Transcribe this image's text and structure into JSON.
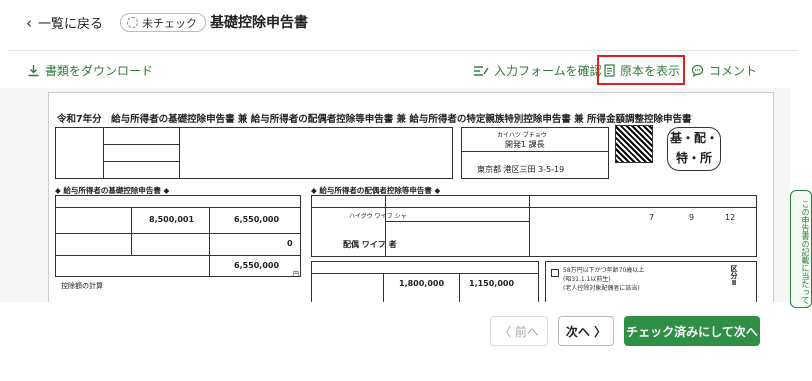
{
  "header": {
    "back_label": "一覧に戻る",
    "status_badge": "未チェック",
    "title": "基礎控除申告書"
  },
  "toolbar": {
    "download_label": "書類をダウンロード",
    "confirm_form_label": "入力フォームを確認",
    "show_original_label": "原本を表示",
    "comment_label": "コメント"
  },
  "document": {
    "title": "令和7年分　給与所得者の基礎控除申告書 兼 給与所得者の配偶者控除等申告書 兼 給与所得者の特定親族特別控除申告書 兼 所得金額調整控除申告書",
    "employee_kana": "カイハツ ブチョウ",
    "employee_name": "開発1 課長",
    "address": "東京都 港区三田 3-5-19",
    "stamp_line1": "基・配・",
    "stamp_line2": "特・所",
    "section_basic": "◆ 給与所得者の基礎控除申告書 ◆",
    "section_spouse": "◆ 給与所得者の配偶者控除等申告書 ◆",
    "salary_income": "8,500,001",
    "salary_amount": "6,550,000",
    "other_income": "0",
    "total_income": "6,550,000",
    "spouse_kana": "ハイグウ ワイフ シャ",
    "spouse_name": "配偶 ワイフ 者",
    "spouse_birth_month": "7",
    "spouse_birth_day": "9",
    "spouse_birth_unit": "12",
    "spouse_salary_income": "1,800,000",
    "spouse_salary_amount": "1,150,000",
    "spouse_note1": "58万円以下かつ年齢70歳以上",
    "spouse_note2": "(昭31.1.1以前生)",
    "spouse_note3": "(老人控除対象配偶者に該当)",
    "calc_label": "控除額の計算",
    "unit_yen": "円",
    "category_label": "区分Ⅱ"
  },
  "side_tab": {
    "label": "この申告書の記載に当たって"
  },
  "footer": {
    "prev_label": "〈 前へ",
    "next_label": "次へ 〉",
    "done_label": "チェック済みにして次へ"
  }
}
